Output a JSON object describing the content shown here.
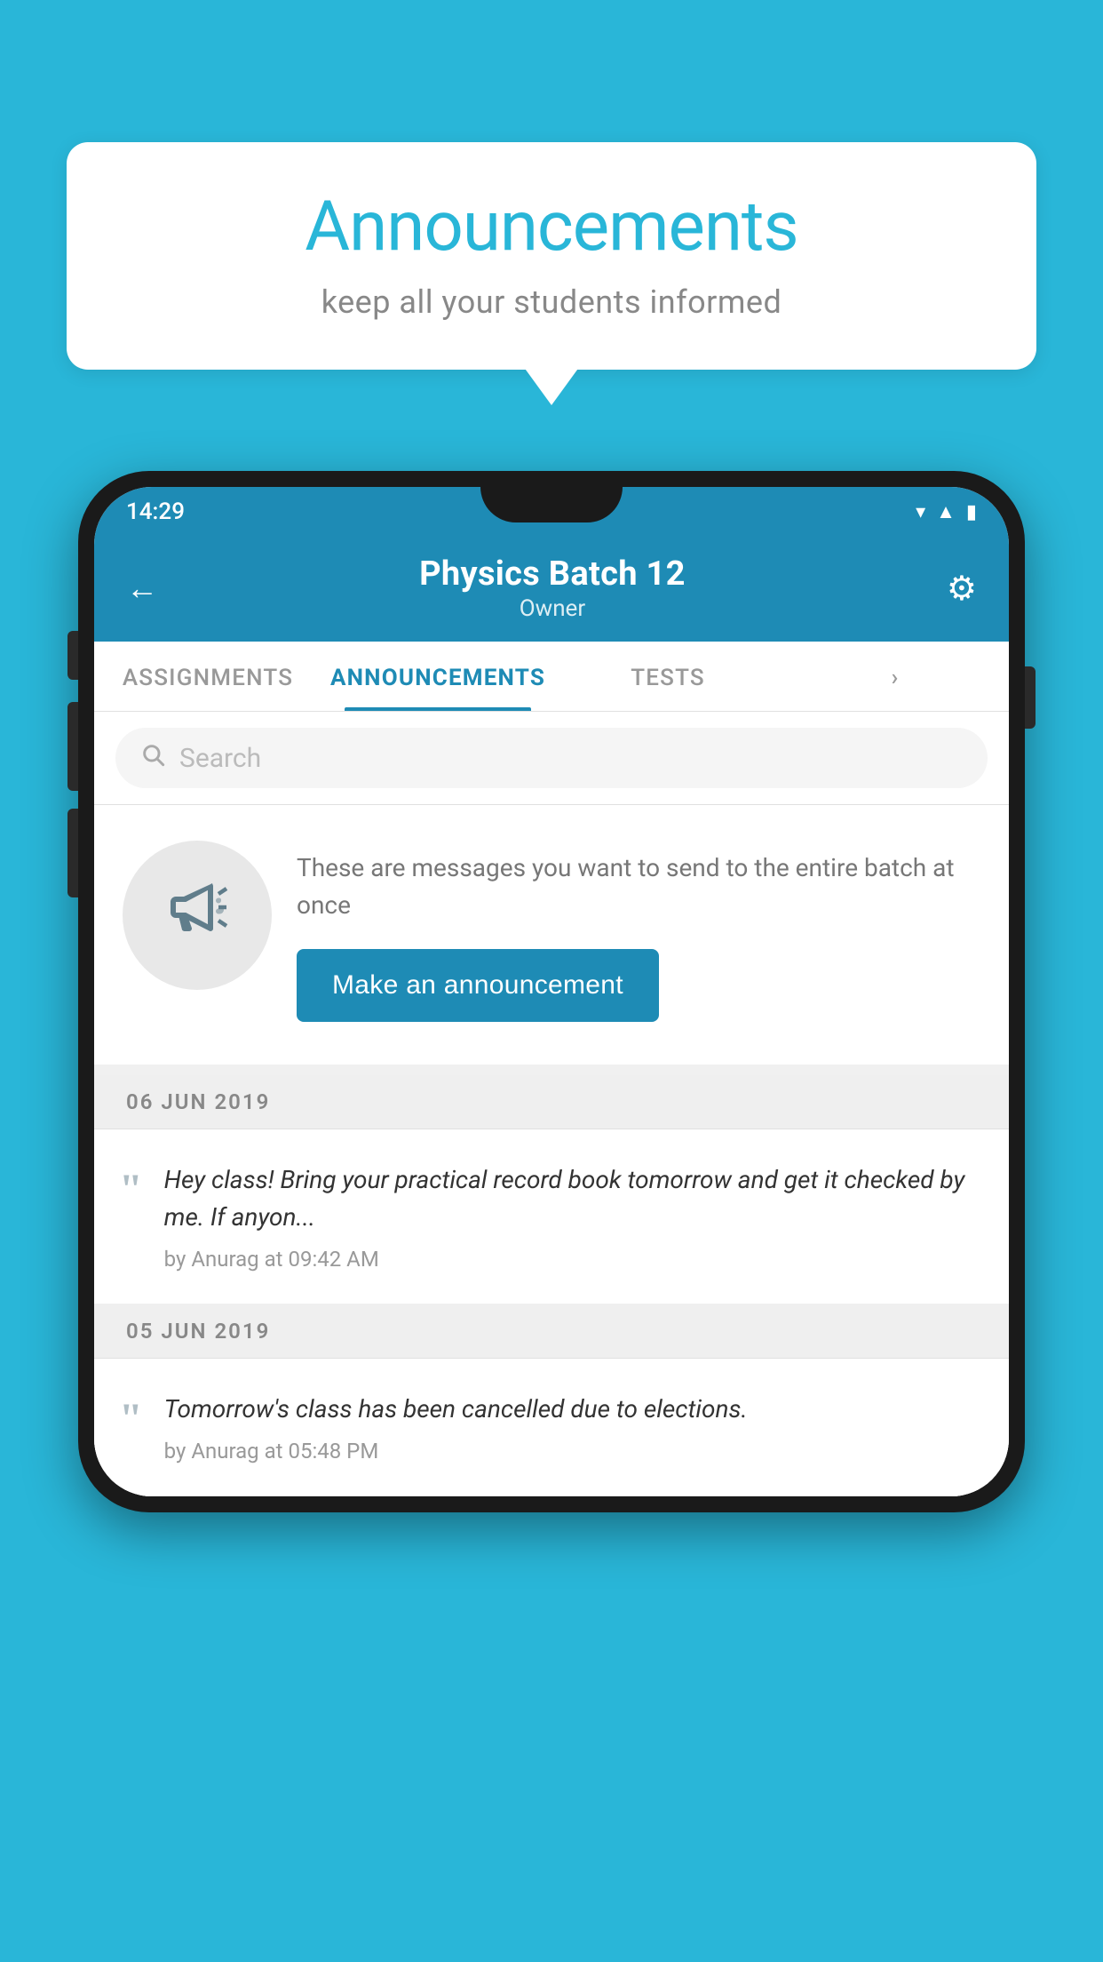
{
  "bubble": {
    "title": "Announcements",
    "subtitle": "keep all your students informed"
  },
  "status_bar": {
    "time": "14:29",
    "icons": [
      "wifi",
      "signal",
      "battery"
    ]
  },
  "header": {
    "title": "Physics Batch 12",
    "subtitle": "Owner",
    "back_label": "←",
    "gear_label": "⚙"
  },
  "tabs": [
    {
      "label": "ASSIGNMENTS",
      "active": false
    },
    {
      "label": "ANNOUNCEMENTS",
      "active": true
    },
    {
      "label": "TESTS",
      "active": false
    },
    {
      "label": "",
      "active": false
    }
  ],
  "search": {
    "placeholder": "Search"
  },
  "announcement_prompt": {
    "description": "These are messages you want to send to the entire batch at once",
    "button_label": "Make an announcement"
  },
  "announcements": [
    {
      "date": "06  JUN  2019",
      "text": "Hey class! Bring your practical record book tomorrow and get it checked by me. If anyon...",
      "meta": "by Anurag at 09:42 AM"
    },
    {
      "date": "05  JUN  2019",
      "text": "Tomorrow's class has been cancelled due to elections.",
      "meta": "by Anurag at 05:48 PM"
    }
  ],
  "colors": {
    "primary": "#1e8bb5",
    "background": "#29b6d8",
    "white": "#ffffff"
  }
}
